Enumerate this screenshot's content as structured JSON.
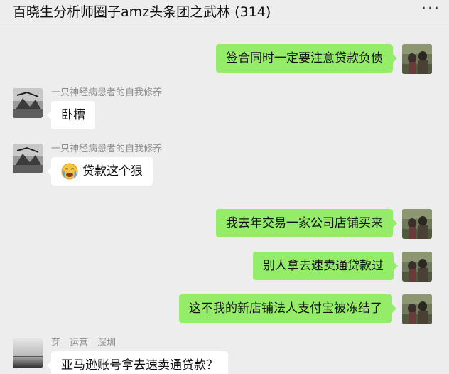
{
  "header": {
    "title": "百晓生分析师圈子amz头条团之武林 (314)",
    "more_icon": "more-dots-icon",
    "more_glyph": "···"
  },
  "messages": [
    {
      "side": "out",
      "text": "签合同时一定要注意贷款负债"
    },
    {
      "side": "in",
      "sender": "一只神经病患者的自我修养",
      "text": "卧槽"
    },
    {
      "side": "in",
      "sender": "一只神经病患者的自我修养",
      "emoji": "crying-face-icon",
      "text": "贷款这个狠"
    },
    {
      "side": "out",
      "text": "我去年交易一家公司店铺买来"
    },
    {
      "side": "out",
      "text": "别人拿去速卖通贷款过"
    },
    {
      "side": "out",
      "text": "这不我的新店铺法人支付宝被冻结了"
    },
    {
      "side": "in",
      "sender": "芽—运营—深圳",
      "text": "亚马逊账号拿去速卖通贷款？"
    }
  ],
  "colors": {
    "background": "#ededed",
    "outgoing_bubble": "#95ec69",
    "incoming_bubble": "#ffffff",
    "sender_name": "#8e8e8e"
  }
}
